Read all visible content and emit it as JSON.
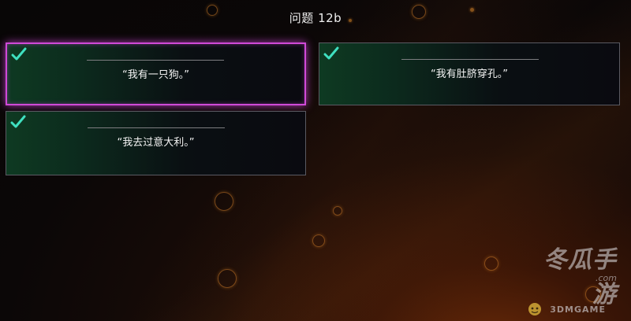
{
  "question": {
    "title": "问题 12b"
  },
  "answers": [
    {
      "text": "“我有一只狗。”",
      "selected": true,
      "checked": true
    },
    {
      "text": "“我有肚脐穿孔。”",
      "selected": false,
      "checked": true
    },
    {
      "text": "“我去过意大利。”",
      "selected": false,
      "checked": true
    }
  ],
  "watermark": {
    "brand_cn": "冬瓜手游",
    "brand_en": "3DMGAME",
    "domain_suffix": ".com"
  },
  "colors": {
    "selection_border": "#d04ad8",
    "check_mark": "#3fe0c0",
    "card_green": "#0e3a22"
  },
  "icons": {
    "check": "check-icon",
    "mascot": "mascot-icon"
  }
}
